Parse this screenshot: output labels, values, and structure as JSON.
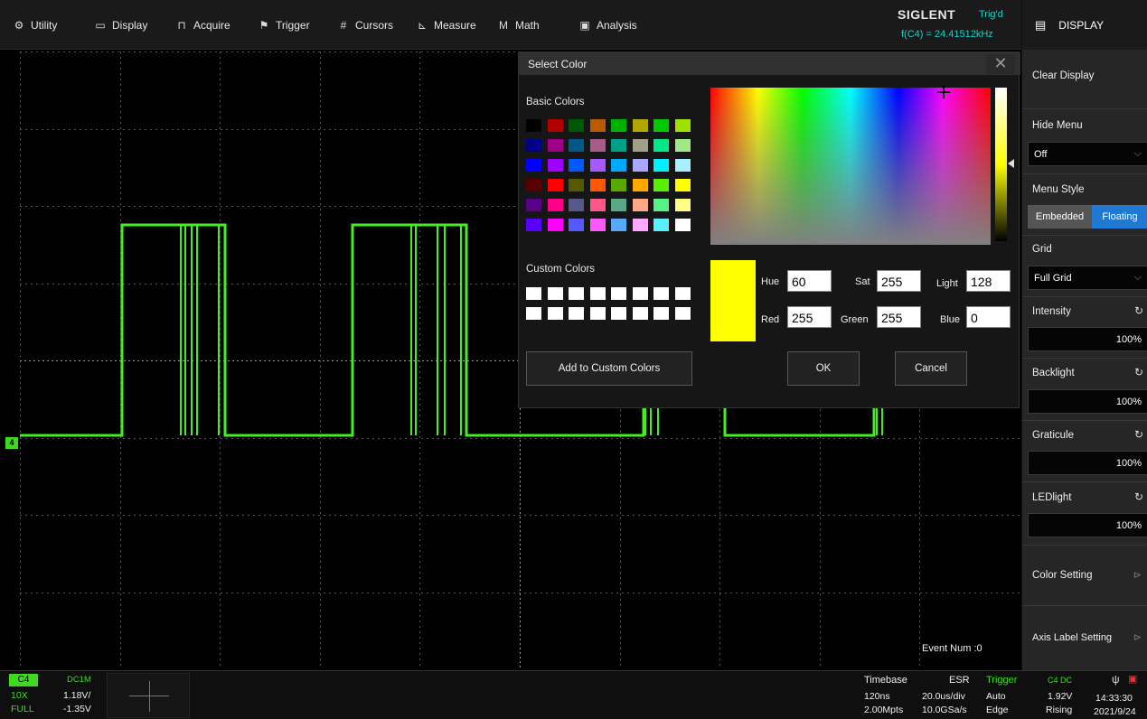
{
  "topbar": {
    "items": [
      {
        "label": "Utility",
        "icon": "gear-icon"
      },
      {
        "label": "Display",
        "icon": "monitor-icon"
      },
      {
        "label": "Acquire",
        "icon": "acquire-icon"
      },
      {
        "label": "Trigger",
        "icon": "flag-icon"
      },
      {
        "label": "Cursors",
        "icon": "cursor-icon"
      },
      {
        "label": "Measure",
        "icon": "measure-icon"
      },
      {
        "label": "Math",
        "icon": "math-icon"
      },
      {
        "label": "Analysis",
        "icon": "analysis-icon"
      }
    ],
    "brand": "SIGLENT",
    "trig_state": "Trig'd",
    "frequency": "f(C4) = 24.41512kHz"
  },
  "right_panel": {
    "header": "DISPLAY",
    "clear_display": "Clear Display",
    "hide_menu": {
      "label": "Hide Menu",
      "value": "Off"
    },
    "menu_style": {
      "label": "Menu Style",
      "embedded": "Embedded",
      "floating": "Floating",
      "selected": "Floating"
    },
    "grid": {
      "label": "Grid",
      "value": "Full Grid"
    },
    "intensity": {
      "label": "Intensity",
      "value": "100%"
    },
    "backlight": {
      "label": "Backlight",
      "value": "100%"
    },
    "graticule": {
      "label": "Graticule",
      "value": "100%"
    },
    "ledlight": {
      "label": "LEDlight",
      "value": "100%"
    },
    "color_setting": "Color Setting",
    "axis_label_setting": "Axis Label Setting"
  },
  "scope": {
    "event_num": "Event Num :0",
    "channel_marker": "4",
    "trace_color": "#44ee22"
  },
  "dialog": {
    "title": "Select Color",
    "close": "✕",
    "basic_colors_label": "Basic Colors",
    "custom_colors_label": "Custom Colors",
    "basic_colors": [
      [
        "#000000",
        "#b00000",
        "#005800",
        "#b85a00",
        "#00b000",
        "#b0a800",
        "#00c800",
        "#a0e000"
      ],
      [
        "#000088",
        "#a00088",
        "#005888",
        "#a85a88",
        "#00a088",
        "#a0a088",
        "#00e888",
        "#a0e888"
      ],
      [
        "#0000ff",
        "#a000ff",
        "#0058ff",
        "#a858ff",
        "#00a8ff",
        "#a8a8ff",
        "#00f0ff",
        "#a8f0ff"
      ],
      [
        "#580000",
        "#ff0000",
        "#585800",
        "#ff5800",
        "#58a800",
        "#ffa800",
        "#58f000",
        "#ffff00"
      ],
      [
        "#580088",
        "#ff0088",
        "#585888",
        "#ff5888",
        "#58a888",
        "#ffa888",
        "#58f088",
        "#ffff88"
      ],
      [
        "#5800ff",
        "#ff00ff",
        "#5858ff",
        "#ff58ff",
        "#58a8ff",
        "#ffa8ff",
        "#58f0ff",
        "#ffffff"
      ]
    ],
    "custom_colors_count": 16,
    "current_color": "#ffff00",
    "hue_label": "Hue",
    "hue": "60",
    "sat_label": "Sat",
    "sat": "255",
    "light_label": "Light",
    "light": "128",
    "red_label": "Red",
    "red": "255",
    "green_label": "Green",
    "green": "255",
    "blue_label": "Blue",
    "blue": "0",
    "add_custom": "Add to Custom Colors",
    "ok": "OK",
    "cancel": "Cancel"
  },
  "bottom": {
    "channel": "C4",
    "coupling": "DC1M",
    "probe": "10X",
    "scale": "1.18V/",
    "bw": "FULL",
    "offset": "-1.35V",
    "timebase_label": "Timebase",
    "esr": "ESR",
    "delay": "120ns",
    "time_div": "20.0us/div",
    "mem_depth": "2.00Mpts",
    "sample_rate": "10.0GSa/s",
    "trigger_label": "Trigger",
    "trig_src": "C4 DC",
    "trig_mode": "Auto",
    "trig_level": "1.92V",
    "trig_type": "Edge",
    "trig_slope": "Rising",
    "time": "14:33:30",
    "date": "2021/9/24"
  }
}
